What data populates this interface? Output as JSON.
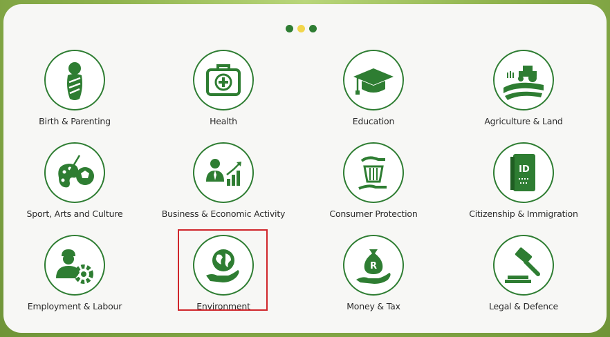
{
  "colors": {
    "primary_green": "#2e7d32",
    "dot_active": "#f2d64b",
    "highlight": "#d0262b"
  },
  "pager": {
    "dots": [
      {
        "active": false,
        "icon": "dot-icon"
      },
      {
        "active": true,
        "icon": "dot-icon"
      },
      {
        "active": false,
        "icon": "dot-icon"
      }
    ]
  },
  "categories": [
    {
      "label": "Birth & Parenting",
      "icon": "baby-icon"
    },
    {
      "label": "Health",
      "icon": "first-aid-kit-icon"
    },
    {
      "label": "Education",
      "icon": "graduation-cap-icon"
    },
    {
      "label": "Agriculture & Land",
      "icon": "tractor-field-icon"
    },
    {
      "label": "Sport, Arts and Culture",
      "icon": "palette-ball-icon"
    },
    {
      "label": "Business & Economic Activity",
      "icon": "businessman-chart-icon"
    },
    {
      "label": "Consumer Protection",
      "icon": "basket-hands-icon"
    },
    {
      "label": "Citizenship & Immigration",
      "icon": "id-document-icon"
    },
    {
      "label": "Employment & Labour",
      "icon": "worker-gear-icon"
    },
    {
      "label": "Environment",
      "icon": "globe-hand-icon",
      "highlighted": true
    },
    {
      "label": "Money & Tax",
      "icon": "money-bag-hand-icon"
    },
    {
      "label": "Legal & Defence",
      "icon": "gavel-icon"
    }
  ]
}
